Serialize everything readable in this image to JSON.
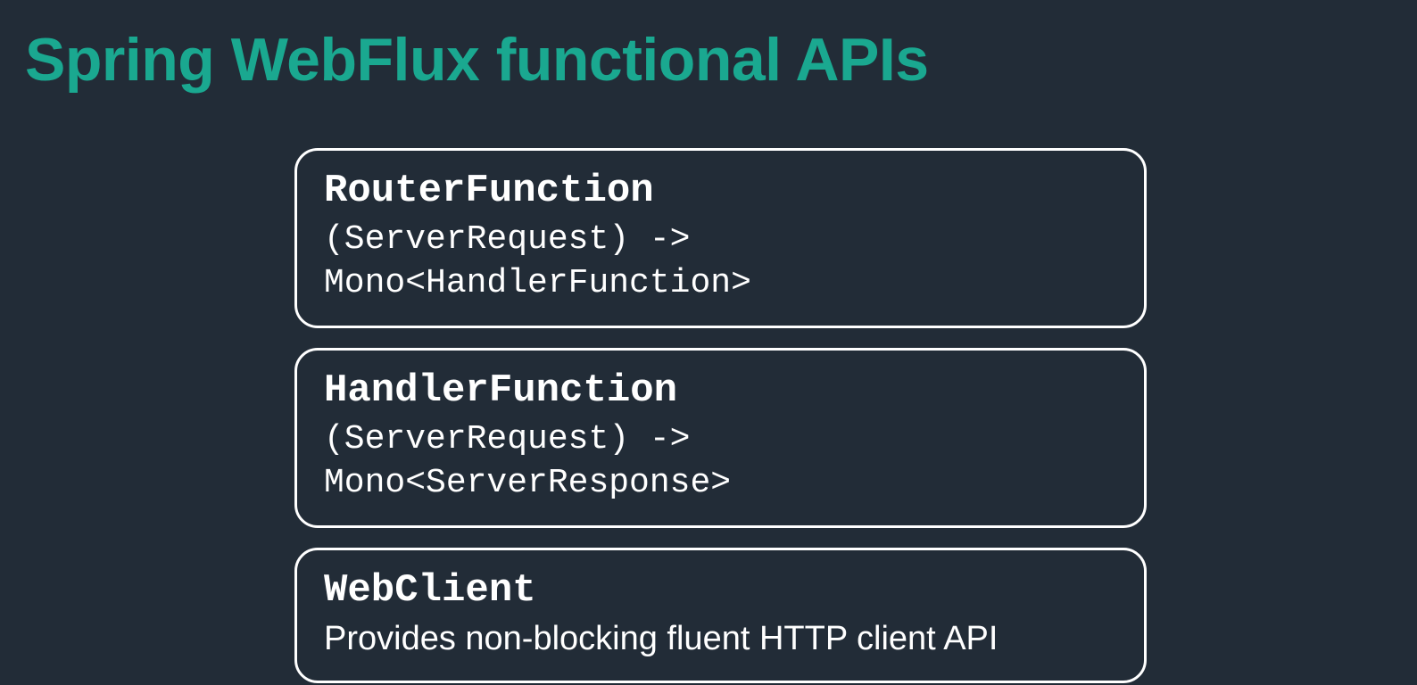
{
  "title": "Spring WebFlux functional APIs",
  "cards": [
    {
      "name": "RouterFunction",
      "signature": "(ServerRequest) -> Mono<HandlerFunction>",
      "descriptionType": "mono"
    },
    {
      "name": "HandlerFunction",
      "signature": "(ServerRequest) -> Mono<ServerResponse>",
      "descriptionType": "mono"
    },
    {
      "name": "WebClient",
      "description": "Provides non-blocking fluent HTTP client API",
      "descriptionType": "text"
    }
  ],
  "colors": {
    "background": "#222c37",
    "titleAccent": "#1aa890",
    "text": "#ffffff",
    "border": "#ffffff"
  }
}
